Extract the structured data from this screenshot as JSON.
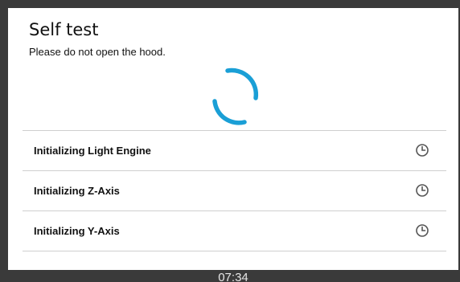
{
  "dialog": {
    "title": "Self test",
    "message": "Please do not open the hood."
  },
  "spinner": {
    "color": "#1a9fd6",
    "icon": "loading-spinner"
  },
  "tasks": [
    {
      "label": "Initializing Light Engine",
      "status_icon": "clock-icon"
    },
    {
      "label": "Initializing Z-Axis",
      "status_icon": "clock-icon"
    },
    {
      "label": "Initializing Y-Axis",
      "status_icon": "clock-icon"
    }
  ],
  "statusbar": {
    "time": "07:34"
  }
}
